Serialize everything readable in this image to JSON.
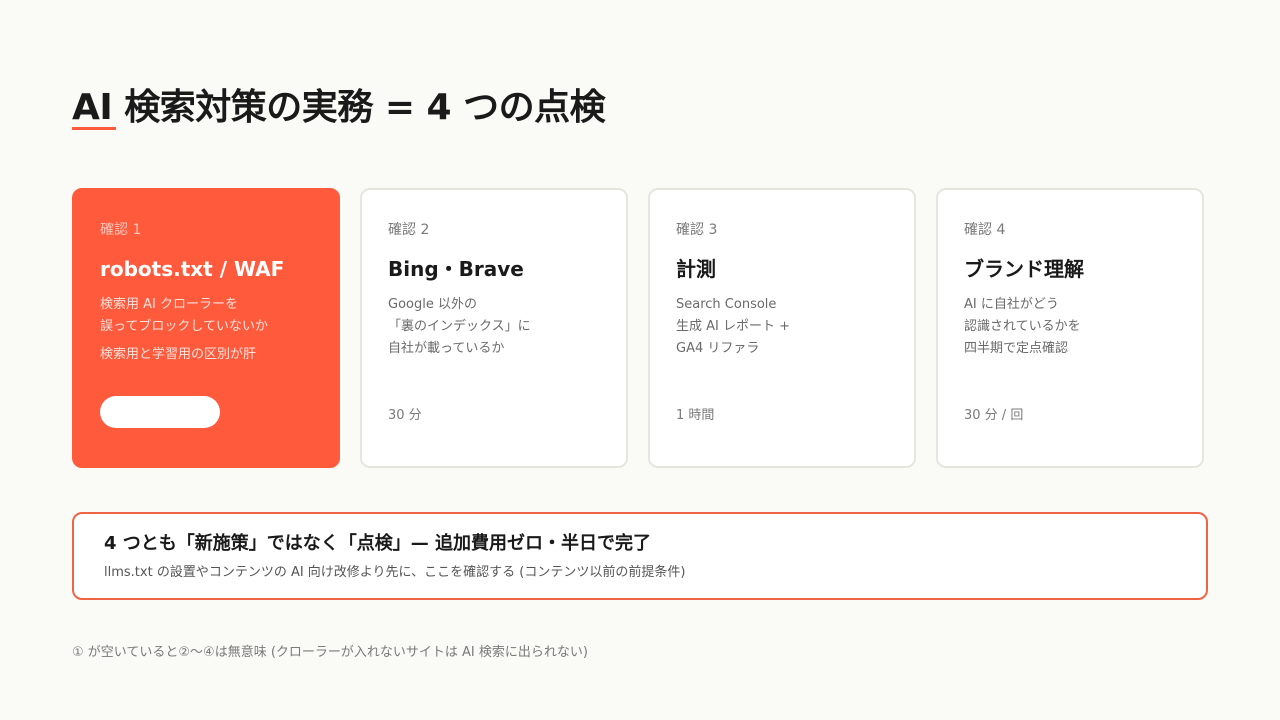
{
  "title": "AI 検索対策の実務 = 4 つの点検",
  "colors": {
    "accent": "#ff5a3c",
    "background": "#fafaf6"
  },
  "cards": [
    {
      "label": "確認 1",
      "title": "robots.txt / WAF",
      "desc": [
        "検索用 AI クローラーを",
        "誤ってブロックしていないか"
      ],
      "note": "検索用と学習用の区別が肝",
      "highlighted": true
    },
    {
      "label": "確認 2",
      "title": "Bing・Brave",
      "desc": [
        "Google 以外の",
        "「裏のインデックス」に",
        "自社が載っているか"
      ],
      "time": "30 分"
    },
    {
      "label": "確認 3",
      "title": "計測",
      "desc": [
        "Search Console",
        "生成 AI レポート +",
        "GA4 リファラ"
      ],
      "time": "1 時間"
    },
    {
      "label": "確認 4",
      "title": "ブランド理解",
      "desc": [
        "AI に自社がどう",
        "認識されているかを",
        "四半期で定点確認"
      ],
      "time": "30 分 / 回"
    }
  ],
  "callout": {
    "title": "4 つとも「新施策」ではなく「点検」— 追加費用ゼロ・半日で完了",
    "subtitle": "llms.txt の設置やコンテンツの AI 向け改修より先に、ここを確認する (コンテンツ以前の前提条件)"
  },
  "footnote": "① が空いていると②〜④は無意味 (クローラーが入れないサイトは AI 検索に出られない)"
}
